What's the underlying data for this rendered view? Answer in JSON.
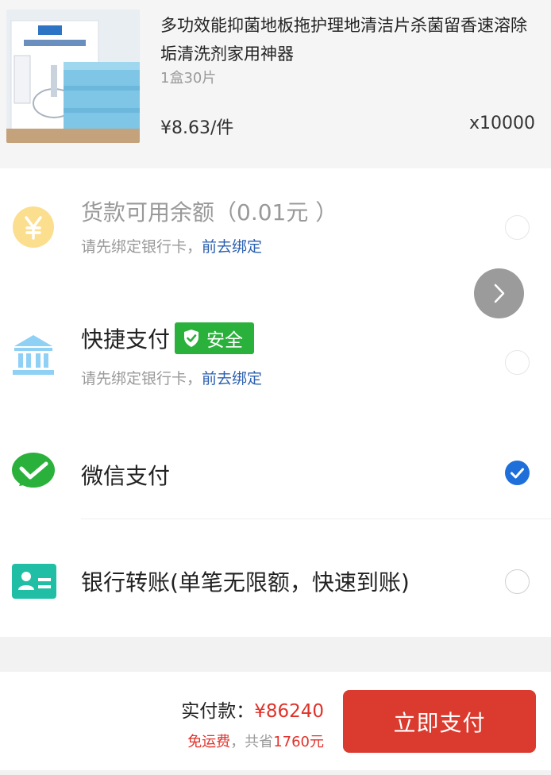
{
  "product": {
    "title": "多功效能抑菌地板拖护理地清洁片杀菌留香速溶除垢清洗剂家用神器",
    "spec": "1盒30片",
    "unit_price": "¥8.63/件",
    "quantity": "x10000"
  },
  "payment": {
    "balance": {
      "title": "货款可用余额（0.01元 ）",
      "sub_prefix": "请先绑定银行卡，",
      "sub_link": "前去绑定",
      "icon": "yen-coin-icon",
      "selected": false,
      "enabled": false
    },
    "quick": {
      "title": "快捷支付",
      "badge": "安全",
      "sub_prefix": "请先绑定银行卡，",
      "sub_link": "前去绑定",
      "icon": "bank-icon",
      "selected": false
    },
    "wechat": {
      "title": "微信支付",
      "icon": "wechat-pay-icon",
      "selected": true
    },
    "bank_transfer": {
      "title": "银行转账(单笔无限额，快速到账)",
      "icon": "id-card-icon",
      "selected": false
    }
  },
  "footer": {
    "total_label": "实付款：",
    "total_amount": "¥86240",
    "free_shipping": "免运费",
    "saving_prefix": "，共省",
    "saving_amount": "1760元",
    "pay_button": "立即支付"
  },
  "colors": {
    "accent_red": "#db3a2e",
    "price_red": "#e0322a",
    "link_blue": "#2b5fb0",
    "wechat_green": "#2ab13b",
    "radio_checked": "#1e6fd9"
  }
}
